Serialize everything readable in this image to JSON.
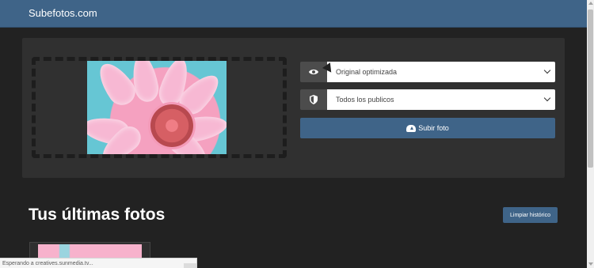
{
  "navbar": {
    "brand": "Subefotos.com"
  },
  "upload_panel": {
    "visibility": {
      "icon": "eye-icon",
      "value": "Original optimizada"
    },
    "audience": {
      "icon": "shield-icon",
      "value": "Todos los publicos"
    },
    "upload_button": {
      "icon": "cloud-upload-icon",
      "label": "Subir foto"
    }
  },
  "recent": {
    "heading": "Tus últimas fotos",
    "clear_label": "Limpiar histórico"
  },
  "status_bar": {
    "text": "Esperando a creatives.sunmedia.tv..."
  },
  "colors": {
    "brand": "#3f6488",
    "background": "#222222",
    "panel": "#303030",
    "accent_button": "#3f6488"
  }
}
